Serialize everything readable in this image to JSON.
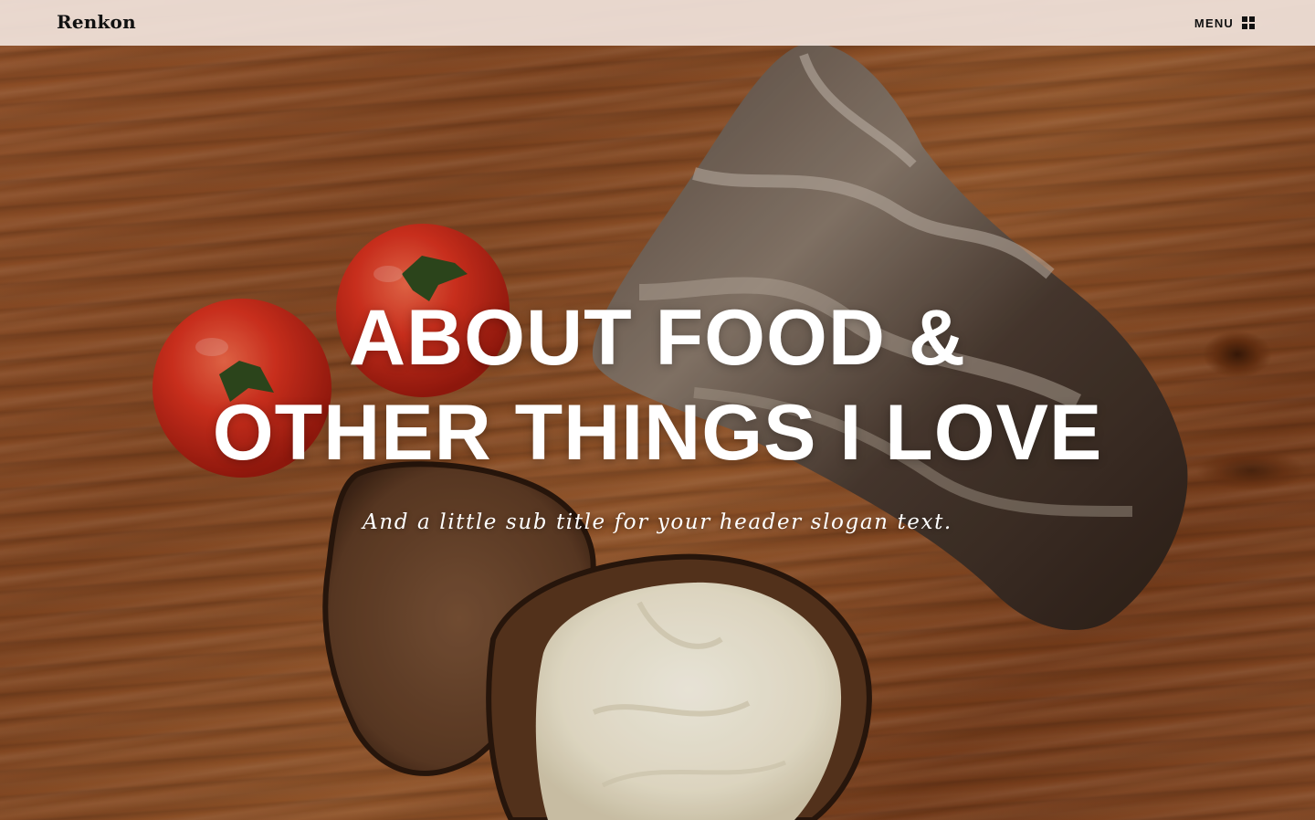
{
  "header": {
    "brand": "Renkon",
    "menu_label": "MENU",
    "menu_icon": "grid-icon"
  },
  "hero": {
    "title_lines": [
      "ABOUT FOOD &",
      "OTHER THINGS I LOVE"
    ],
    "subtitle": "And a little sub title for your header slogan text.",
    "background_image": "wooden table with tomatoes and bread"
  },
  "colors": {
    "topbar": "#f0e2da",
    "text_dark": "#111111",
    "hero_text": "#ffffff",
    "wood": "#8a4a22"
  }
}
